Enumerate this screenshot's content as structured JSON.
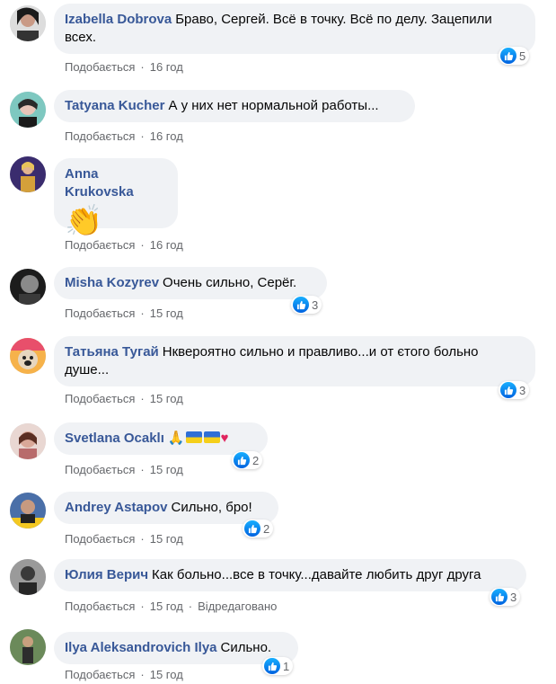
{
  "comments": [
    {
      "author": "Izabella Dobrova",
      "text": "Браво, Сергей. Всё в точку. Всё по делу. Зацепили всех.",
      "like_label": "Подобається",
      "time": "16 год",
      "reactions": "5"
    },
    {
      "author": "Tatyana Kucher",
      "text": "А у них нет нормальной работы...",
      "like_label": "Подобається",
      "time": "16 год"
    },
    {
      "author": "Anna Krukovska",
      "emoji": "👏",
      "like_label": "Подобається",
      "time": "16 год"
    },
    {
      "author": "Misha Kozyrev",
      "text": "Очень сильно, Серёг.",
      "like_label": "Подобається",
      "time": "15 год",
      "reactions": "3"
    },
    {
      "author": "Татьяна Тугай",
      "text": "Нквероятно сильно и правливо...и от єтого больно душе...",
      "like_label": "Подобається",
      "time": "15 год",
      "reactions": "3"
    },
    {
      "author": "Svetlana Ocaklı",
      "text": "🙏",
      "like_label": "Подобається",
      "time": "15 год",
      "reactions": "2"
    },
    {
      "author": "Andrey Astapov",
      "text": "Сильно, бро!",
      "like_label": "Подобається",
      "time": "15 год",
      "reactions": "2"
    },
    {
      "author": "Юлия Верич",
      "text": "Как больно...все в точку...давайте любить друг друга",
      "like_label": "Подобається",
      "time": "15 год",
      "edited": "Відредаговано",
      "reactions": "3"
    },
    {
      "author": "Ilya Aleksandrovich Ilya",
      "text": "Сильно.",
      "like_label": "Подобається",
      "time": "15 год",
      "reactions": "1"
    }
  ],
  "colors": {
    "author": "#385898",
    "bubble": "#f0f2f5",
    "meta": "#65676b",
    "like_blue": "#1877f2"
  },
  "icons": {
    "reaction": "like-icon",
    "flag": "ukraine-flag-icon",
    "heart": "heart-icon"
  }
}
